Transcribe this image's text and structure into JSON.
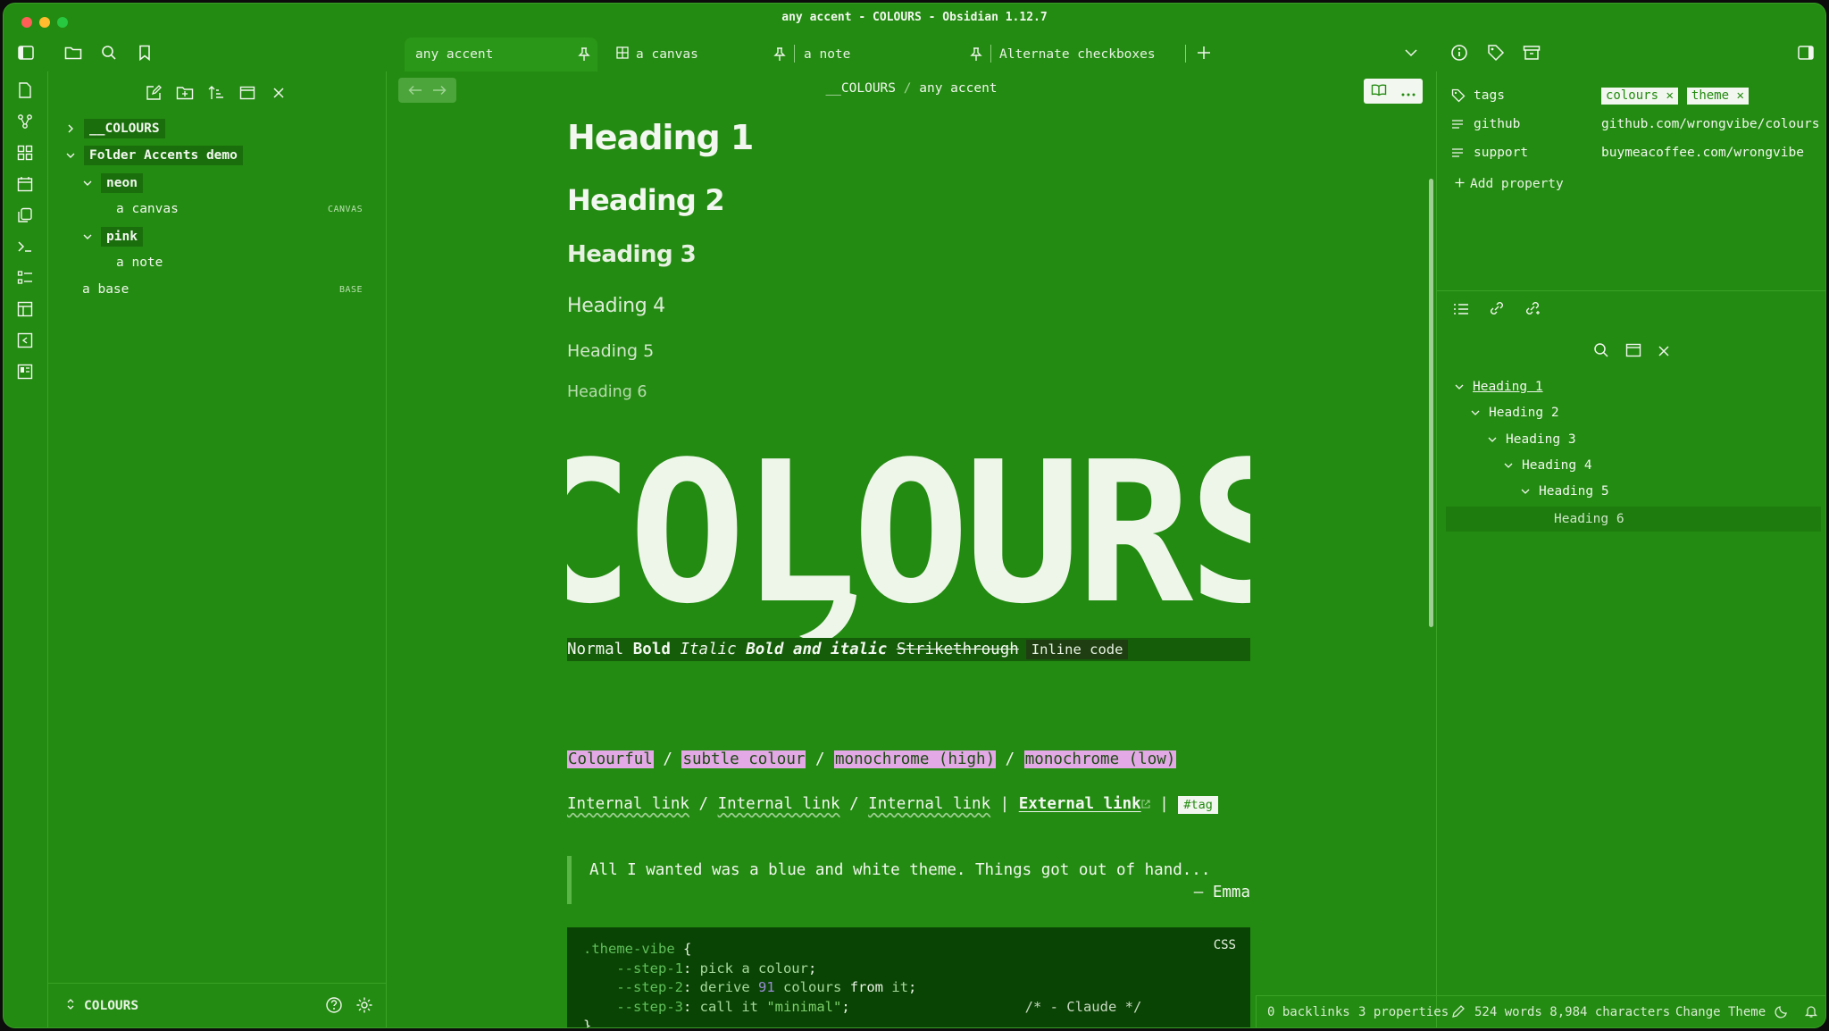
{
  "window": {
    "title": "any accent - COLOURS - Obsidian 1.12.7"
  },
  "tabs": [
    {
      "label": "any accent",
      "active": true
    },
    {
      "label": "a canvas",
      "active": false
    },
    {
      "label": "a note",
      "active": false
    },
    {
      "label": "Alternate checkboxes",
      "active": false
    }
  ],
  "file_tree": {
    "root_folder": "__COLOURS",
    "demo_folder": "Folder Accents demo",
    "neon_folder": "neon",
    "canvas_file": "a canvas",
    "canvas_badge": "CANVAS",
    "pink_folder": "pink",
    "note_file": "a note",
    "base_file": "a base",
    "base_badge": "BASE"
  },
  "vault": {
    "name": "COLOURS"
  },
  "breadcrumb": {
    "folder": "__COLOURS",
    "separator": "/",
    "file": "any accent"
  },
  "note": {
    "h1": "Heading 1",
    "h2": "Heading 2",
    "h3": "Heading 3",
    "h4": "Heading 4",
    "h5": "Heading 5",
    "h6": "Heading 6",
    "logo_text": "COLOURS",
    "fmt": {
      "normal": "Normal",
      "bold": "Bold",
      "italic": "Italic",
      "bold_italic": "Bold and italic",
      "strike": "Strikethrough",
      "code": "Inline code"
    },
    "highlights": [
      "Colourful",
      "subtle colour",
      "monochrome (high)",
      "monochrome (low)"
    ],
    "links": {
      "internal_1": "Internal link",
      "internal_2": "Internal link",
      "internal_3": "Internal link",
      "external": "External link",
      "tag": "#tag"
    },
    "quote": {
      "text": "All I wanted was a blue and white theme. Things got out of hand...",
      "author": "— Emma"
    },
    "code": {
      "lang": "CSS",
      "selector": ".theme-vibe",
      "l1_prop": "--step-1",
      "l1_val": "pick a colour",
      "l2_prop": "--step-2",
      "l2_v1": "derive",
      "l2_num": "91",
      "l2_v2": "colours",
      "l2_from": "from",
      "l2_it": "it",
      "l3_prop": "--step-3",
      "l3_val": "call it",
      "l3_str": "\"minimal\"",
      "l3_comment": "/* - Claude */"
    }
  },
  "properties": [
    {
      "key": "tags",
      "values": [
        "colours",
        "theme"
      ]
    },
    {
      "key": "github",
      "value": "github.com/wrongvibe/colours"
    },
    {
      "key": "support",
      "value": "buymeacoffee.com/wrongvibe"
    }
  ],
  "add_property": "Add property",
  "outline": [
    "Heading 1",
    "Heading 2",
    "Heading 3",
    "Heading 4",
    "Heading 5",
    "Heading 6"
  ],
  "status": {
    "backlinks": "0 backlinks",
    "properties": "3 properties",
    "counts": "524 words 8,984 characters",
    "theme": "Change Theme"
  },
  "colors": {
    "background": "#238b11",
    "text": "#f2f7ef",
    "highlight": "#e3a8e6",
    "code_bg": "#0a4404"
  }
}
